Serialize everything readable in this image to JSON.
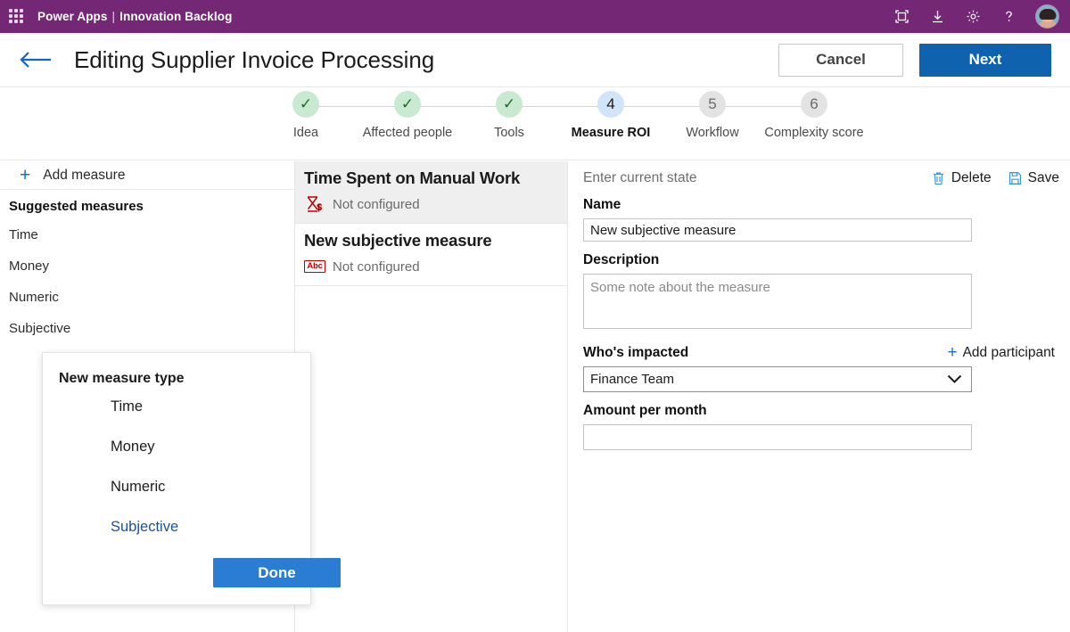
{
  "topbar": {
    "waffle_icon": "waffle-grid-icon",
    "app_name": "Power Apps",
    "separator": "|",
    "workspace": "Innovation Backlog",
    "icons": [
      {
        "name": "fullscreen-icon",
        "label": "Fullscreen"
      },
      {
        "name": "download-icon",
        "label": "Download"
      },
      {
        "name": "gear-icon",
        "label": "Settings"
      },
      {
        "name": "help-icon",
        "label": "?"
      }
    ],
    "avatar_label": "User avatar",
    "bg_color": "#742774"
  },
  "header": {
    "back_icon": "back-arrow-icon",
    "title": "Editing Supplier Invoice Processing",
    "cancel_label": "Cancel",
    "next_label": "Next",
    "next_color": "#0f62ae"
  },
  "stepper": {
    "steps": [
      {
        "number": "1",
        "label": "Idea",
        "state": "done",
        "glyph": "✓"
      },
      {
        "number": "2",
        "label": "Affected people",
        "state": "done",
        "glyph": "✓"
      },
      {
        "number": "3",
        "label": "Tools",
        "state": "done",
        "glyph": "✓"
      },
      {
        "number": "4",
        "label": "Measure ROI",
        "state": "active",
        "glyph": "4"
      },
      {
        "number": "5",
        "label": "Workflow",
        "state": "todo",
        "glyph": "5"
      },
      {
        "number": "6",
        "label": "Complexity score",
        "state": "todo",
        "glyph": "6"
      }
    ],
    "done_color": "#c9ead0",
    "active_color": "#d2e4f7",
    "todo_color": "#e3e3e3"
  },
  "left_pane": {
    "add_measure_label": "Add measure",
    "add_icon": "plus-icon",
    "suggested_header": "Suggested measures",
    "suggested_items": [
      {
        "label": "Time"
      },
      {
        "label": "Money"
      },
      {
        "label": "Numeric"
      },
      {
        "label": "Subjective"
      }
    ]
  },
  "middle_pane": {
    "measures": [
      {
        "title": "Time Spent on Manual Work",
        "icon": "hourglass-money-icon",
        "status": "Not configured",
        "selected": true
      },
      {
        "title": "New subjective measure",
        "icon": "abc-icon",
        "icon_text": "Abc",
        "status": "Not configured",
        "selected": false
      }
    ],
    "status_color": "#6a6a6a"
  },
  "right_pane": {
    "hint": "Enter current state",
    "delete_label": "Delete",
    "delete_icon": "trash-icon",
    "save_label": "Save",
    "save_icon": "save-disk-icon",
    "name_label": "Name",
    "name_value": "New subjective measure",
    "description_label": "Description",
    "description_value": "",
    "description_placeholder": "Some note about the measure",
    "whos_impacted_label": "Who's impacted",
    "add_participant_label": "Add participant",
    "add_participant_icon": "plus-icon",
    "participant_selected": "Finance Team",
    "participant_options": [
      "Finance Team"
    ],
    "chevron_icon": "chevron-down-icon",
    "amount_label": "Amount per month",
    "amount_value": "",
    "amount_placeholder": ""
  },
  "dialog": {
    "title": "New measure type",
    "options": [
      {
        "label": "Time",
        "selected": false
      },
      {
        "label": "Money",
        "selected": false
      },
      {
        "label": "Numeric",
        "selected": false
      },
      {
        "label": "Subjective",
        "selected": true
      }
    ],
    "done_label": "Done",
    "done_color": "#2b7cd3",
    "selected_color": "#1d4f9c"
  }
}
